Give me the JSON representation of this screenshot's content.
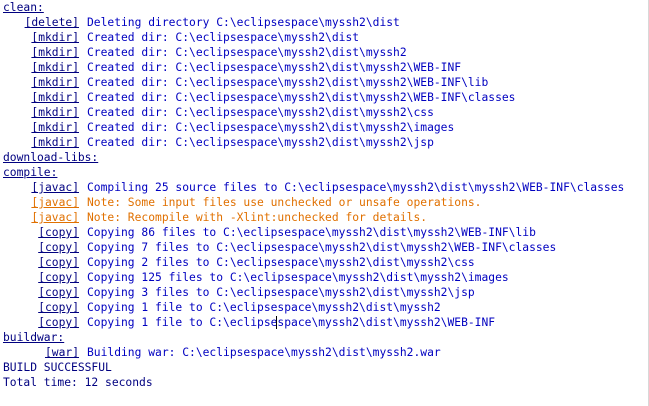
{
  "console": {
    "lines": [
      {
        "kind": "target",
        "text": "clean:"
      },
      {
        "kind": "task",
        "task": "[delete]",
        "msg": "Deleting directory C:\\eclipsespace\\myssh2\\dist",
        "level": "info"
      },
      {
        "kind": "task",
        "task": "[mkdir]",
        "msg": "Created dir: C:\\eclipsespace\\myssh2\\dist",
        "level": "info"
      },
      {
        "kind": "task",
        "task": "[mkdir]",
        "msg": "Created dir: C:\\eclipsespace\\myssh2\\dist\\myssh2",
        "level": "info"
      },
      {
        "kind": "task",
        "task": "[mkdir]",
        "msg": "Created dir: C:\\eclipsespace\\myssh2\\dist\\myssh2\\WEB-INF",
        "level": "info"
      },
      {
        "kind": "task",
        "task": "[mkdir]",
        "msg": "Created dir: C:\\eclipsespace\\myssh2\\dist\\myssh2\\WEB-INF\\lib",
        "level": "info"
      },
      {
        "kind": "task",
        "task": "[mkdir]",
        "msg": "Created dir: C:\\eclipsespace\\myssh2\\dist\\myssh2\\WEB-INF\\classes",
        "level": "info"
      },
      {
        "kind": "task",
        "task": "[mkdir]",
        "msg": "Created dir: C:\\eclipsespace\\myssh2\\dist\\myssh2\\css",
        "level": "info"
      },
      {
        "kind": "task",
        "task": "[mkdir]",
        "msg": "Created dir: C:\\eclipsespace\\myssh2\\dist\\myssh2\\images",
        "level": "info"
      },
      {
        "kind": "task",
        "task": "[mkdir]",
        "msg": "Created dir: C:\\eclipsespace\\myssh2\\dist\\myssh2\\jsp",
        "level": "info"
      },
      {
        "kind": "target",
        "text": "download-libs:"
      },
      {
        "kind": "target",
        "text": "compile:"
      },
      {
        "kind": "task",
        "task": "[javac]",
        "msg": "Compiling 25 source files to C:\\eclipsespace\\myssh2\\dist\\myssh2\\WEB-INF\\classes",
        "level": "info"
      },
      {
        "kind": "task",
        "task": "[javac]",
        "msg": "Note: Some input files use unchecked or unsafe operations.",
        "level": "warn"
      },
      {
        "kind": "task",
        "task": "[javac]",
        "msg": "Note: Recompile with -Xlint:unchecked for details.",
        "level": "warn"
      },
      {
        "kind": "task",
        "task": "[copy]",
        "msg": "Copying 86 files to C:\\eclipsespace\\myssh2\\dist\\myssh2\\WEB-INF\\lib",
        "level": "info"
      },
      {
        "kind": "task",
        "task": "[copy]",
        "msg": "Copying 7 files to C:\\eclipsespace\\myssh2\\dist\\myssh2\\WEB-INF\\classes",
        "level": "info"
      },
      {
        "kind": "task",
        "task": "[copy]",
        "msg": "Copying 2 files to C:\\eclipsespace\\myssh2\\dist\\myssh2\\css",
        "level": "info"
      },
      {
        "kind": "task",
        "task": "[copy]",
        "msg": "Copying 125 files to C:\\eclipsespace\\myssh2\\dist\\myssh2\\images",
        "level": "info"
      },
      {
        "kind": "task",
        "task": "[copy]",
        "msg": "Copying 3 files to C:\\eclipsespace\\myssh2\\dist\\myssh2\\jsp",
        "level": "info"
      },
      {
        "kind": "task",
        "task": "[copy]",
        "msg": "Copying 1 file to C:\\eclipsespace\\myssh2\\dist\\myssh2",
        "level": "info"
      },
      {
        "kind": "task",
        "task": "[copy]",
        "msg": "Copying 1 file to C:\\eclipsespace\\myssh2\\dist\\myssh2\\WEB-INF",
        "level": "info"
      },
      {
        "kind": "target",
        "text": "buildwar:"
      },
      {
        "kind": "task",
        "task": "[war]",
        "msg": "Building war: C:\\eclipsespace\\myssh2\\dist\\myssh2.war",
        "level": "info"
      },
      {
        "kind": "plain",
        "text": "BUILD SUCCESSFUL"
      },
      {
        "kind": "plain",
        "text": "Total time: 12 seconds"
      }
    ]
  },
  "colors": {
    "target": "#000080",
    "info": "#0000c0",
    "warn": "#e07000",
    "background": "#ffffff"
  }
}
